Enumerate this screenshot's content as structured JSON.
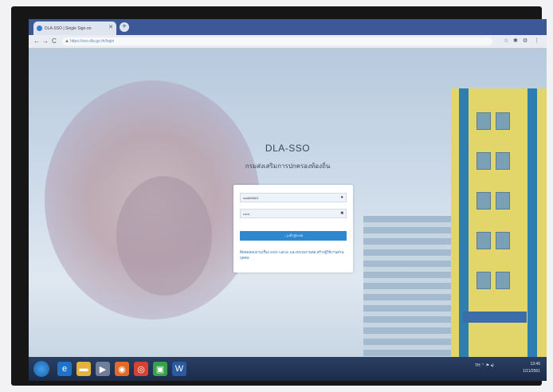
{
  "browser": {
    "tab_title": "DLA-SSO | Single Sign-on",
    "tab_close": "✕",
    "new_tab": "+",
    "url": "https://sso.dla.go.th/login",
    "nav": {
      "back": "←",
      "forward": "→",
      "reload": "C"
    },
    "tools": [
      "☆",
      "✱",
      "⚙",
      "⋮"
    ]
  },
  "login": {
    "title": "DLA-SSO",
    "subtitle": "กรมส่งเสริมการปกครองท้องถิ่น",
    "username_value": "xxx600601",
    "password_value": "••••••",
    "login_button": "→] เข้าสู่ระบบ",
    "help_text": "ติดต่อสอบถามเรื่อง SSO Admin และหน่วยงานต่อ สร้างผู้ใช้งานส่วนบุคคล"
  },
  "taskbar": {
    "clock_time": "13:46",
    "clock_date": "1/11/2561",
    "tray": "TH ⌃ ⚑ ◂)"
  },
  "icons": {
    "user": "user-icon",
    "lock": "lock-icon"
  }
}
